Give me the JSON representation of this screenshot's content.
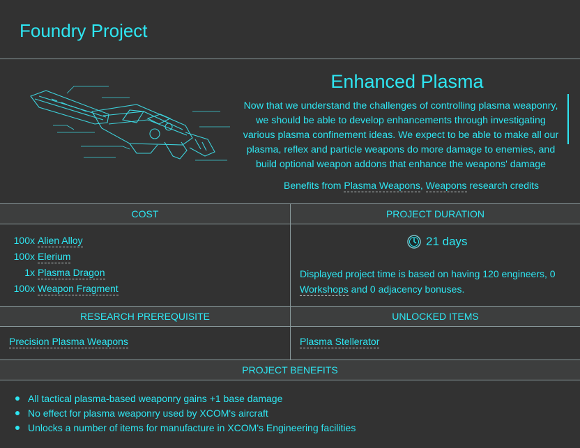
{
  "page": {
    "title": "Foundry Project",
    "project_name": "Enhanced Plasma",
    "description": "Now that we understand the challenges of controlling plasma weaponry, we should be able to develop enhancements through investigating various plasma confinement ideas. We expect to be able to make all our plasma, reflex and particle weapons do more damage to enemies, and build optional weapon addons that enhance the weapons' damage capabilities even further.",
    "benefits_prefix": "Benefits from",
    "benefits_link_1": "Plasma Weapons",
    "benefits_sep": ",",
    "benefits_link_2": "Weapons",
    "benefits_suffix": "research credits"
  },
  "cost": {
    "header": "COST",
    "items": [
      {
        "qty": "100x",
        "name": "Alien Alloy"
      },
      {
        "qty": "100x",
        "name": "Elerium"
      },
      {
        "qty": "1x",
        "name": "Plasma Dragon"
      },
      {
        "qty": "100x",
        "name": "Weapon Fragment"
      }
    ]
  },
  "duration": {
    "header": "PROJECT DURATION",
    "value": "21 days",
    "note_prefix": "Displayed project time is based on having 120 engineers, 0",
    "note_link": "Workshops",
    "note_suffix": "and 0 adjacency bonuses."
  },
  "prereq": {
    "header": "RESEARCH PREREQUISITE",
    "item": "Precision Plasma Weapons"
  },
  "unlocked": {
    "header": "UNLOCKED ITEMS",
    "item": "Plasma Stellerator"
  },
  "benefits": {
    "header": "PROJECT BENEFITS",
    "items": [
      "All tactical plasma-based weaponry gains +1 base damage",
      "No effect for plasma weaponry used by XCOM's aircraft",
      "Unlocks a number of items for manufacture in XCOM's Engineering facilities"
    ]
  },
  "colors": {
    "background": "#323232",
    "accent": "#2ee6f2",
    "header_band": "#3d3e3e",
    "divider": "#8a9a9c"
  },
  "icons": [
    "plasma-weapon-schematic",
    "clock-icon"
  ]
}
